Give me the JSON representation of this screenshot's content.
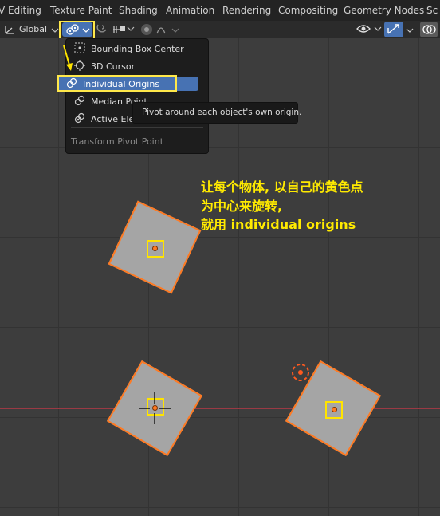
{
  "header": {
    "workspace_tabs": [
      "V Editing",
      "Texture Paint",
      "Shading",
      "Animation",
      "Rendering",
      "Compositing",
      "Geometry Nodes",
      "Sc"
    ]
  },
  "toolbar": {
    "orientation_label": "Global",
    "orientation_icon": "transform-orientation-icon",
    "pivot_icon": "individual-origins-icon",
    "snap_icon": "magnet-icon",
    "proportional_icon": "proportional-edit-icon"
  },
  "pivot_menu": {
    "items": [
      {
        "label": "Bounding Box Center",
        "icon": "bounding-box-center-icon"
      },
      {
        "label": "3D Cursor",
        "icon": "cursor-3d-icon"
      },
      {
        "label": "Individual Origins",
        "icon": "individual-origins-icon",
        "selected": true
      },
      {
        "label": "Median Point",
        "icon": "median-point-icon"
      },
      {
        "label": "Active Ele",
        "icon": "active-element-icon"
      }
    ],
    "footer": "Transform Pivot Point"
  },
  "tooltip": {
    "text": "Pivot around each object's own origin."
  },
  "annotation": {
    "lines": [
      "让每个物体, 以自己的黄色点",
      "为中心来旋转,",
      "就用 individual origins"
    ],
    "color": "#ffea00"
  },
  "colors": {
    "selection_highlight": "#4772b3",
    "object_outline": "#ff7a22",
    "callout": "#ffe84a"
  }
}
